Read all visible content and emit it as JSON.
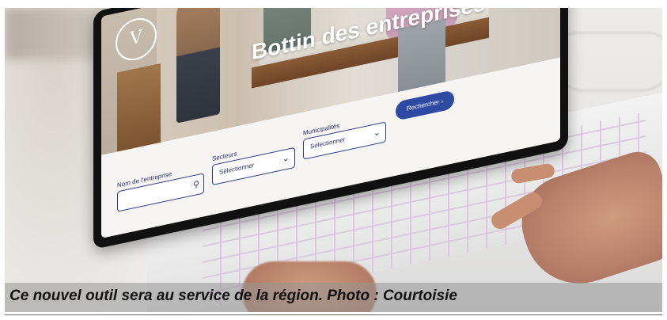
{
  "site": {
    "logo_glyph": "V",
    "hero_title": "Bottin des entreprises"
  },
  "search_form": {
    "company_name": {
      "label": "Nom de l'entreprise",
      "value": ""
    },
    "sectors": {
      "label": "Secteurs",
      "selected": "Sélectionner"
    },
    "municipalities": {
      "label": "Municipalités",
      "selected": "Sélectionner"
    },
    "search_button": "Rechercher ›"
  },
  "caption": "Ce nouvel outil sera au service de la région. Photo : Courtoisie",
  "colors": {
    "brand_blue": "#2f4aa3",
    "caption_bar": "#969696"
  }
}
